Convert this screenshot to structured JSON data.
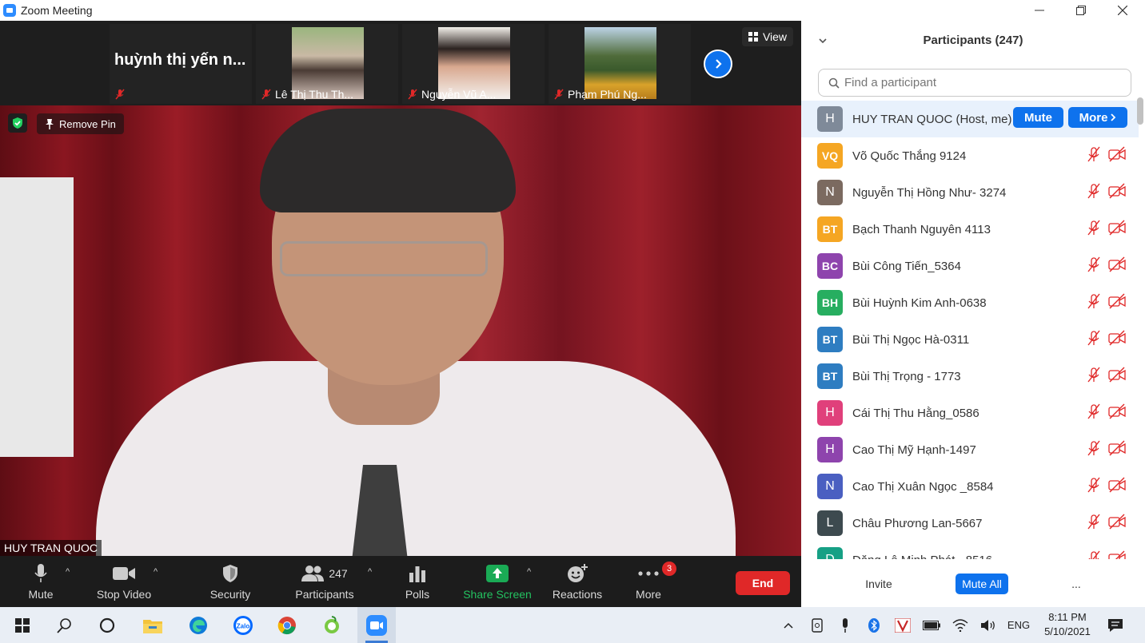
{
  "window": {
    "title": "Zoom Meeting",
    "controls": [
      "minimize",
      "restore",
      "close"
    ]
  },
  "video_strip": {
    "tiles": [
      {
        "name": "huỳnh thị yến n...",
        "kind": "name-only",
        "muted": true
      },
      {
        "name": "Lê Thị Thu Th...",
        "kind": "photo",
        "muted": true
      },
      {
        "name": "Nguyễn Vũ A...",
        "kind": "photo",
        "muted": true
      },
      {
        "name": "Phạm Phú Ng...",
        "kind": "photo",
        "muted": true
      }
    ],
    "view_label": "View"
  },
  "main_video": {
    "remove_pin_label": "Remove Pin",
    "speaker_name": "HUY TRAN QUOC"
  },
  "toolbar": {
    "mute_label": "Mute",
    "stop_video_label": "Stop Video",
    "security_label": "Security",
    "participants_label": "Participants",
    "participants_count": "247",
    "polls_label": "Polls",
    "share_screen_label": "Share Screen",
    "reactions_label": "Reactions",
    "more_label": "More",
    "more_badge": "3",
    "end_label": "End"
  },
  "panel": {
    "title": "Participants (247)",
    "search_placeholder": "Find a participant",
    "host": {
      "initial": "H",
      "name": "HUY TRAN QUOC (Host, me)",
      "mute_label": "Mute",
      "more_label": "More",
      "color": "#7f8a99"
    },
    "participants": [
      {
        "initials": "VQ",
        "name": "Võ Quốc Thắng  9124",
        "color": "#f5a623"
      },
      {
        "initials": "N",
        "name": "Nguyễn Thị Hồng Như- 3274",
        "color": "#7b6a60"
      },
      {
        "initials": "BT",
        "name": "Bạch Thanh Nguyên 4113",
        "color": "#f5a623"
      },
      {
        "initials": "BC",
        "name": "Bùi Công Tiến_5364",
        "color": "#8e44ad"
      },
      {
        "initials": "BH",
        "name": "Bùi Huỳnh Kim Anh-0638",
        "color": "#27ae60"
      },
      {
        "initials": "BT",
        "name": "Bùi Thị Ngọc Hà-0311",
        "color": "#2e7dc1"
      },
      {
        "initials": "BT",
        "name": "Bùi Thị Trọng - 1773",
        "color": "#2e7dc1"
      },
      {
        "initials": "H",
        "name": "Cái Thị Thu Hằng_0586",
        "color": "#e0407b"
      },
      {
        "initials": "H",
        "name": "Cao Thị Mỹ Hạnh-1497",
        "color": "#8e44ad"
      },
      {
        "initials": "N",
        "name": "Cao Thị Xuân Ngọc _8584",
        "color": "#4a5fc1"
      },
      {
        "initials": "L",
        "name": "Châu Phương Lan-5667",
        "color": "#3d4a4f"
      },
      {
        "initials": "D",
        "name": "Đặng Lê Minh Phát - 8516",
        "color": "#16a085"
      }
    ],
    "footer": {
      "invite_label": "Invite",
      "mute_all_label": "Mute All",
      "more_label": "..."
    }
  },
  "taskbar": {
    "apps": [
      "windows-start",
      "search",
      "cortana",
      "file-explorer",
      "edge",
      "zalo",
      "chrome",
      "app-green",
      "zoom"
    ],
    "language": "ENG",
    "time": "8:11 PM",
    "date": "5/10/2021"
  },
  "colors": {
    "zoom_blue": "#0e72ed",
    "end_red": "#e02828",
    "muted_red": "#e02828",
    "toolbar_bg": "#1c1c1c",
    "share_green": "#1aaa55"
  }
}
